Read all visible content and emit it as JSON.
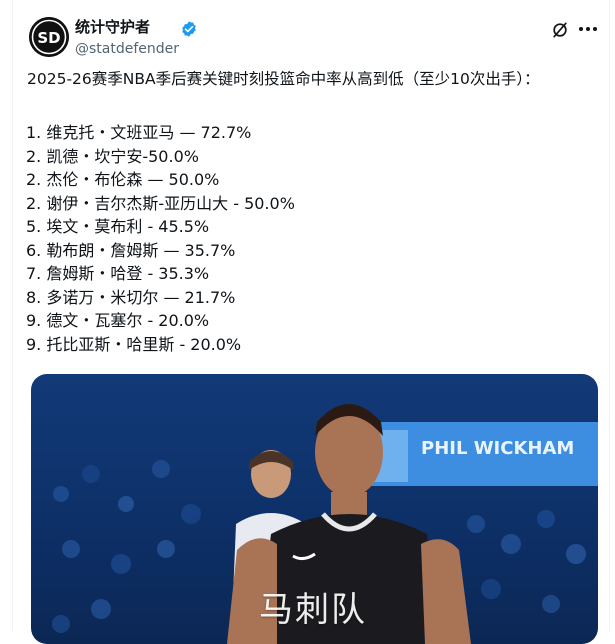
{
  "post": {
    "author": {
      "display_name": "统计守护者",
      "handle": "@statdefender",
      "avatar_initials": "SD",
      "verified_color": "#1d9bf0"
    },
    "headline": "2025-26赛季NBA季后赛关键时刻投篮命中率从高到低（至少10次出手）：",
    "ranking": [
      "1. 维克托・文班亚马 — 72.7%",
      "2. 凯德・坎宁安-50.0%",
      "2. 杰伦・布伦森 — 50.0%",
      "2. 谢伊・吉尔杰斯-亚历山大 - 50.0%",
      "5. 埃文・莫布利 - 45.5%",
      "6. 勒布朗・詹姆斯 — 35.7%",
      "7. 詹姆斯・哈登 - 35.3%",
      "8. 多诺万・米切尔 — 21.7%",
      "9. 德文・瓦塞尔 - 20.0%",
      "9. 托比亚斯・哈里斯 - 20.0%"
    ],
    "media": {
      "caption": "马刺队",
      "banner_text": "PHIL WICKHAM"
    },
    "icons": {
      "grok": "grok-icon",
      "more": "more-icon",
      "verified": "verified-badge-icon"
    }
  }
}
